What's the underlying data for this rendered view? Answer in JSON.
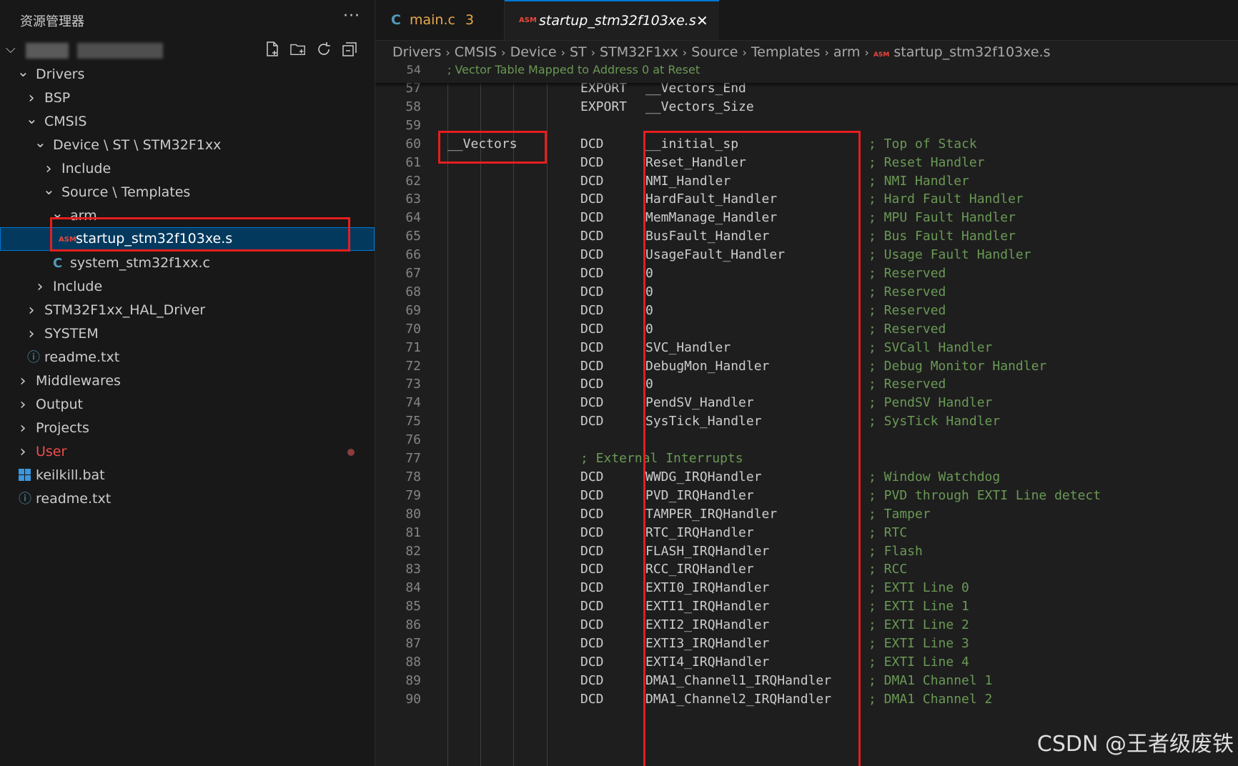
{
  "explorer": {
    "title": "资源管理器",
    "more": "···",
    "workspace_actions": [
      "new-file-icon",
      "new-folder-icon",
      "refresh-icon",
      "collapse-all-icon"
    ],
    "tree": [
      {
        "label": "Drivers",
        "type": "folder",
        "expanded": true
      },
      {
        "label": "BSP",
        "type": "folder",
        "expanded": false
      },
      {
        "label": "CMSIS",
        "type": "folder",
        "expanded": true
      },
      {
        "label": "Device \\ ST \\ STM32F1xx",
        "type": "folder",
        "expanded": true
      },
      {
        "label": "Include",
        "type": "folder",
        "expanded": false
      },
      {
        "label": "Source \\ Templates",
        "type": "folder",
        "expanded": true
      },
      {
        "label": "arm",
        "type": "folder",
        "expanded": true
      },
      {
        "label": "startup_stm32f103xe.s",
        "type": "asm",
        "selected": true
      },
      {
        "label": "system_stm32f1xx.c",
        "type": "c"
      },
      {
        "label": "Include",
        "type": "folder",
        "expanded": false
      },
      {
        "label": "STM32F1xx_HAL_Driver",
        "type": "folder",
        "expanded": false
      },
      {
        "label": "SYSTEM",
        "type": "folder",
        "expanded": false
      },
      {
        "label": "readme.txt",
        "type": "info"
      },
      {
        "label": "Middlewares",
        "type": "folder",
        "expanded": false
      },
      {
        "label": "Output",
        "type": "folder",
        "expanded": false
      },
      {
        "label": "Projects",
        "type": "folder",
        "expanded": false
      },
      {
        "label": "User",
        "type": "folder",
        "expanded": false,
        "modified": true
      },
      {
        "label": "keilkill.bat",
        "type": "bat"
      },
      {
        "label": "readme.txt",
        "type": "info"
      }
    ]
  },
  "tabs": [
    {
      "icon": "C",
      "name": "main.c",
      "badge": "3",
      "active": false
    },
    {
      "icon": "ASM",
      "name": "startup_stm32f103xe.s",
      "close": "✕",
      "active": true
    }
  ],
  "breadcrumb": [
    "Drivers",
    "CMSIS",
    "Device",
    "ST",
    "STM32F1xx",
    "Source",
    "Templates",
    "arm"
  ],
  "breadcrumb_file": "startup_stm32f103xe.s",
  "breadcrumb_file_icon": "ASM",
  "sticky_line": {
    "number": "54",
    "comment": "; Vector Table Mapped to Address 0 at Reset"
  },
  "code_lines": [
    {
      "n": "57",
      "label": "",
      "op": "EXPORT",
      "arg": "__Vectors_End",
      "cmt": ""
    },
    {
      "n": "58",
      "label": "",
      "op": "EXPORT",
      "arg": "__Vectors_Size",
      "cmt": ""
    },
    {
      "n": "59",
      "label": "",
      "op": "",
      "arg": "",
      "cmt": ""
    },
    {
      "n": "60",
      "label": "__Vectors",
      "op": "DCD",
      "arg": "__initial_sp",
      "cmt": "; Top of Stack"
    },
    {
      "n": "61",
      "label": "",
      "op": "DCD",
      "arg": "Reset_Handler",
      "cmt": "; Reset Handler"
    },
    {
      "n": "62",
      "label": "",
      "op": "DCD",
      "arg": "NMI_Handler",
      "cmt": "; NMI Handler"
    },
    {
      "n": "63",
      "label": "",
      "op": "DCD",
      "arg": "HardFault_Handler",
      "cmt": "; Hard Fault Handler"
    },
    {
      "n": "64",
      "label": "",
      "op": "DCD",
      "arg": "MemManage_Handler",
      "cmt": "; MPU Fault Handler"
    },
    {
      "n": "65",
      "label": "",
      "op": "DCD",
      "arg": "BusFault_Handler",
      "cmt": "; Bus Fault Handler"
    },
    {
      "n": "66",
      "label": "",
      "op": "DCD",
      "arg": "UsageFault_Handler",
      "cmt": "; Usage Fault Handler"
    },
    {
      "n": "67",
      "label": "",
      "op": "DCD",
      "arg": "0",
      "cmt": "; Reserved"
    },
    {
      "n": "68",
      "label": "",
      "op": "DCD",
      "arg": "0",
      "cmt": "; Reserved"
    },
    {
      "n": "69",
      "label": "",
      "op": "DCD",
      "arg": "0",
      "cmt": "; Reserved"
    },
    {
      "n": "70",
      "label": "",
      "op": "DCD",
      "arg": "0",
      "cmt": "; Reserved"
    },
    {
      "n": "71",
      "label": "",
      "op": "DCD",
      "arg": "SVC_Handler",
      "cmt": "; SVCall Handler"
    },
    {
      "n": "72",
      "label": "",
      "op": "DCD",
      "arg": "DebugMon_Handler",
      "cmt": "; Debug Monitor Handler"
    },
    {
      "n": "73",
      "label": "",
      "op": "DCD",
      "arg": "0",
      "cmt": "; Reserved"
    },
    {
      "n": "74",
      "label": "",
      "op": "DCD",
      "arg": "PendSV_Handler",
      "cmt": "; PendSV Handler"
    },
    {
      "n": "75",
      "label": "",
      "op": "DCD",
      "arg": "SysTick_Handler",
      "cmt": "; SysTick Handler"
    },
    {
      "n": "76",
      "label": "",
      "op": "",
      "arg": "",
      "cmt": ""
    },
    {
      "n": "77",
      "label": "",
      "op": "",
      "arg": "",
      "cmt": "",
      "inline_cmt": "; External Interrupts"
    },
    {
      "n": "78",
      "label": "",
      "op": "DCD",
      "arg": "WWDG_IRQHandler",
      "cmt": "; Window Watchdog"
    },
    {
      "n": "79",
      "label": "",
      "op": "DCD",
      "arg": "PVD_IRQHandler",
      "cmt": "; PVD through EXTI Line detect"
    },
    {
      "n": "80",
      "label": "",
      "op": "DCD",
      "arg": "TAMPER_IRQHandler",
      "cmt": "; Tamper"
    },
    {
      "n": "81",
      "label": "",
      "op": "DCD",
      "arg": "RTC_IRQHandler",
      "cmt": "; RTC"
    },
    {
      "n": "82",
      "label": "",
      "op": "DCD",
      "arg": "FLASH_IRQHandler",
      "cmt": "; Flash"
    },
    {
      "n": "83",
      "label": "",
      "op": "DCD",
      "arg": "RCC_IRQHandler",
      "cmt": "; RCC"
    },
    {
      "n": "84",
      "label": "",
      "op": "DCD",
      "arg": "EXTI0_IRQHandler",
      "cmt": "; EXTI Line 0"
    },
    {
      "n": "85",
      "label": "",
      "op": "DCD",
      "arg": "EXTI1_IRQHandler",
      "cmt": "; EXTI Line 1"
    },
    {
      "n": "86",
      "label": "",
      "op": "DCD",
      "arg": "EXTI2_IRQHandler",
      "cmt": "; EXTI Line 2"
    },
    {
      "n": "87",
      "label": "",
      "op": "DCD",
      "arg": "EXTI3_IRQHandler",
      "cmt": "; EXTI Line 3"
    },
    {
      "n": "88",
      "label": "",
      "op": "DCD",
      "arg": "EXTI4_IRQHandler",
      "cmt": "; EXTI Line 4"
    },
    {
      "n": "89",
      "label": "",
      "op": "DCD",
      "arg": "DMA1_Channel1_IRQHandler",
      "cmt": "; DMA1 Channel 1"
    },
    {
      "n": "90",
      "label": "",
      "op": "DCD",
      "arg": "DMA1_Channel2_IRQHandler",
      "cmt": "; DMA1 Channel 2"
    }
  ],
  "watermark": "CSDN @王者级废铁",
  "colors": {
    "comment": "#6a9955",
    "selection": "#04395e",
    "annotation_red": "#e61e1e",
    "asm_icon": "#e8473d",
    "c_icon": "#519aba"
  }
}
